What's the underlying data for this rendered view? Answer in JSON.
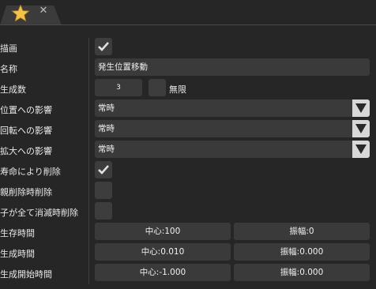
{
  "panel": {
    "labels": {
      "draw": "描画",
      "name": "名称",
      "count": "生成数",
      "pos_effect": "位置への影響",
      "rot_effect": "回転への影響",
      "scale_effect": "拡大への影響",
      "remove_on_life": "寿命により削除",
      "remove_on_parent": "親削除時削除",
      "remove_on_children": "子が全て消滅時削除",
      "life": "生存時間",
      "gen_time": "生成時間",
      "gen_start": "生成開始時間"
    },
    "name_value": "発生位置移動",
    "count_value": "3",
    "infinite_label": "無限",
    "pos_effect_value": "常時",
    "rot_effect_value": "常時",
    "scale_effect_value": "常時",
    "life_center": "中心:100",
    "life_amp": "振幅:0",
    "gen_time_center": "中心:0.010",
    "gen_time_amp": "振幅:0.000",
    "gen_start_center": "中心:-1.000",
    "gen_start_amp": "振幅:0.000"
  },
  "checks": {
    "draw": true,
    "infinite": false,
    "remove_on_life": true,
    "remove_on_parent": false,
    "remove_on_children": false
  },
  "colors": {
    "star": "#f5c242",
    "background": "#262626",
    "field": "#3a3a3a"
  }
}
